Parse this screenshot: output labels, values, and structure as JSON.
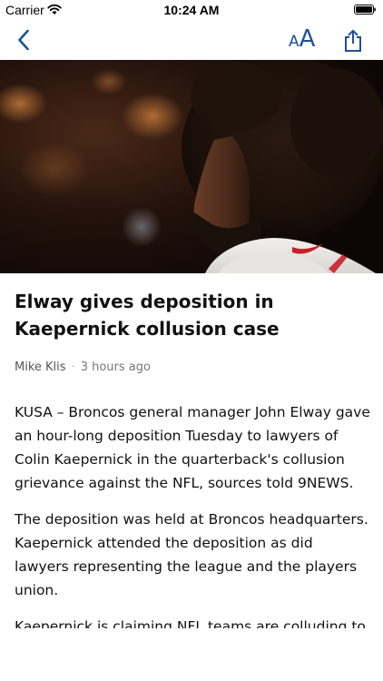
{
  "status_bar": {
    "carrier": "Carrier",
    "time": "10:24 AM"
  },
  "nav": {
    "text_size_small": "A",
    "text_size_large": "A",
    "accent_color": "#1f4f9d"
  },
  "article": {
    "headline": "Elway gives deposition in Kaepernick collusion case",
    "author": "Mike Klis",
    "separator": "·",
    "published": "3 hours ago",
    "paragraphs": [
      "KUSA – Broncos general manager John Elway gave an hour-long deposition Tuesday to lawyers of Colin Kaepernick in the quarterback's collusion grievance against the NFL, sources told 9NEWS.",
      "The deposition was held at Broncos headquarters. Kaepernick attended the deposition as did lawyers representing the league and the players union.",
      "Kaepernick is claiming NFL teams are colluding to keep him from playing quarterback in part because"
    ]
  },
  "icons": {
    "back": "chevron-left-icon",
    "text_size": "text-size-icon",
    "share": "share-icon",
    "wifi": "wifi-icon",
    "battery": "battery-icon"
  }
}
